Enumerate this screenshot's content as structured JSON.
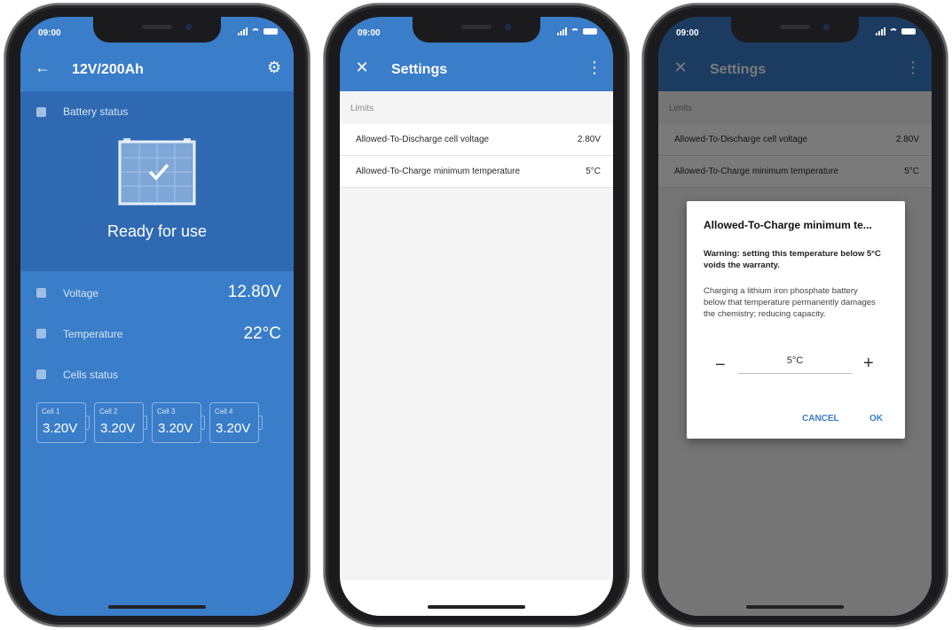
{
  "status_bar": {
    "time": "09:00"
  },
  "screen1": {
    "title": "12V/200Ah",
    "battery_status_label": "Battery status",
    "state_text": "Ready for use",
    "voltage_label": "Voltage",
    "voltage_value": "12.80V",
    "temperature_label": "Temperature",
    "temperature_value": "22°C",
    "cells_status_label": "Cells status",
    "cells": [
      {
        "label": "Cell 1",
        "value": "3.20V"
      },
      {
        "label": "Cell 2",
        "value": "3.20V"
      },
      {
        "label": "Cell 3",
        "value": "3.20V"
      },
      {
        "label": "Cell 4",
        "value": "3.20V"
      }
    ]
  },
  "settings": {
    "title": "Settings",
    "section_label": "Limits",
    "rows": [
      {
        "label": "Allowed-To-Discharge cell voltage",
        "value": "2.80V"
      },
      {
        "label": "Allowed-To-Charge minimum temperature",
        "value": "5°C"
      }
    ]
  },
  "dialog": {
    "title": "Allowed-To-Charge minimum te...",
    "warning": "Warning: setting this temperature below 5°C voids the warranty.",
    "body": "Charging a lithium iron phosphate battery below that temperature permanently damages the chemistry; reducing capacity.",
    "value": "5°C",
    "minus": "−",
    "plus": "+",
    "cancel": "CANCEL",
    "ok": "OK"
  },
  "colors": {
    "accent": "#3a7dc9",
    "accent_dark": "#2f69b2",
    "bg_light": "#f4f4f4"
  },
  "icons": [
    "back-arrow-icon",
    "gear-icon",
    "close-icon",
    "more-vert-icon",
    "battery-check-icon"
  ]
}
